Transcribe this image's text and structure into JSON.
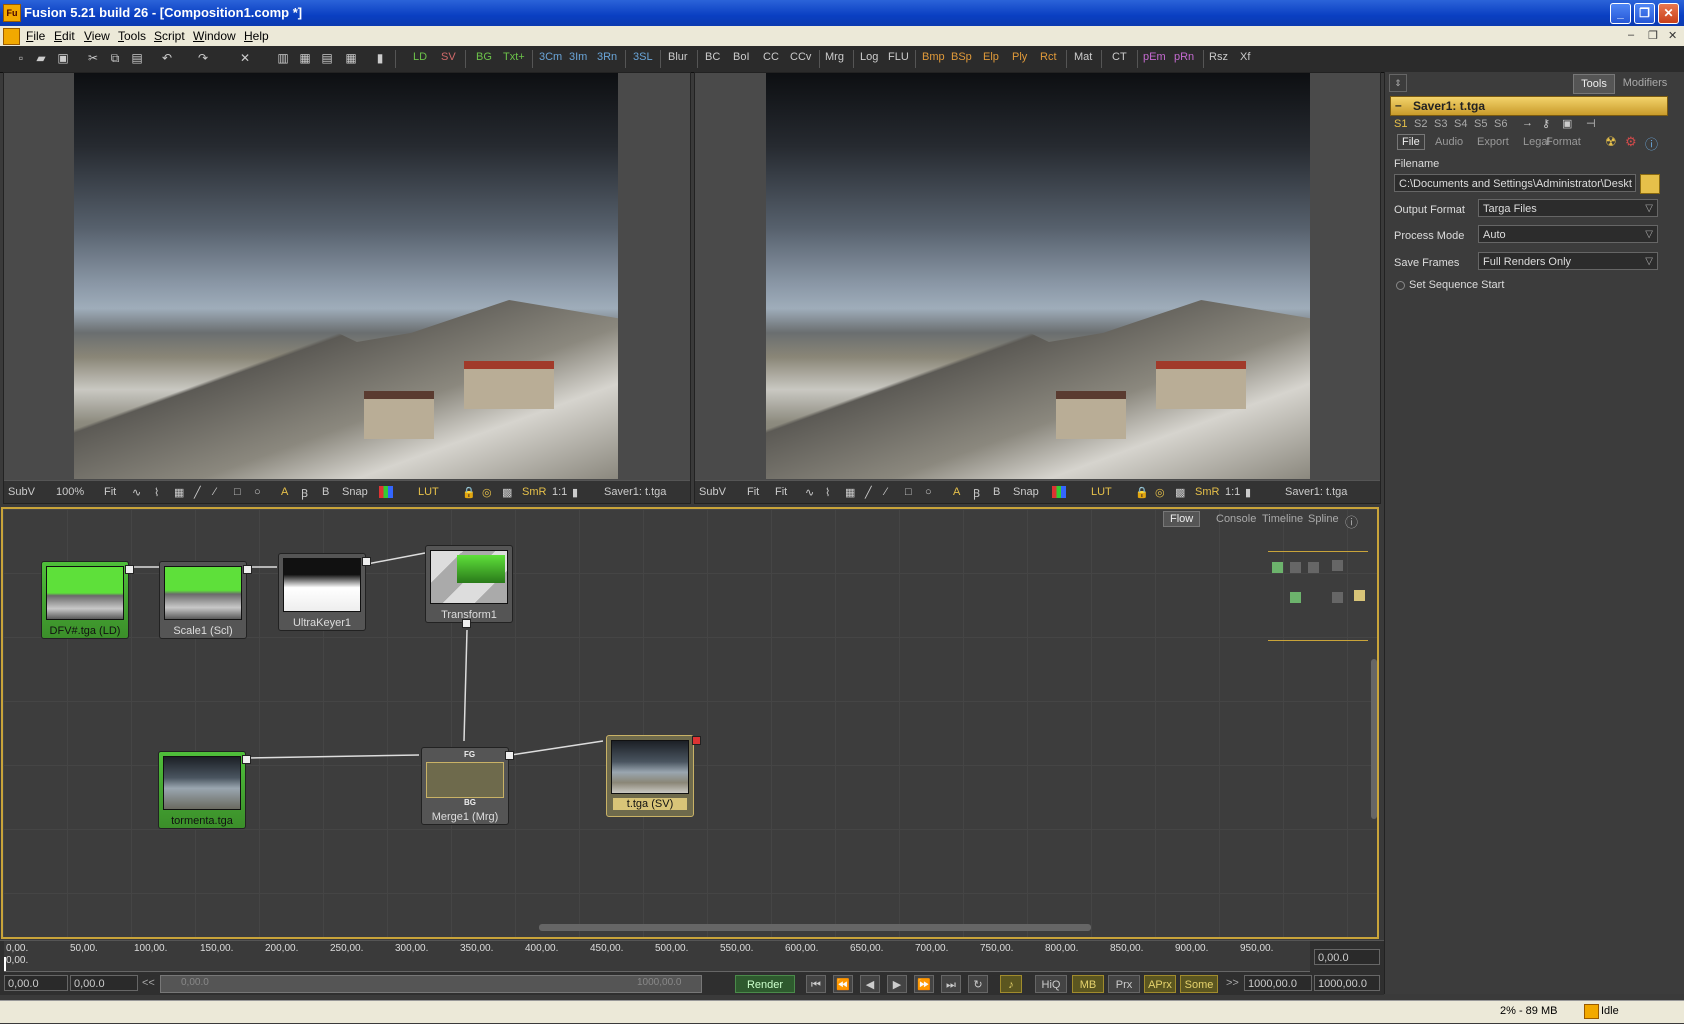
{
  "window": {
    "title": "Fusion 5.21 build 26 - [Composition1.comp *]",
    "app_icon": "Fu"
  },
  "menu": [
    "File",
    "Edit",
    "View",
    "Tools",
    "Script",
    "Window",
    "Help"
  ],
  "toolbar": {
    "groups": [
      [
        "LD",
        "SV"
      ],
      [
        "BG",
        "Txt+"
      ],
      [
        "3Cm",
        "3Im",
        "3Rn"
      ],
      [
        "3SL"
      ],
      [
        "Blur"
      ],
      [
        "BC",
        "BoI",
        "CC",
        "CCv"
      ],
      [
        "Mrg"
      ],
      [
        "Log",
        "FLU"
      ],
      [
        "Bmp",
        "BSp",
        "Elp",
        "Ply",
        "Rct"
      ],
      [
        "Mat"
      ],
      [
        "CT"
      ],
      [
        "pEm",
        "pRn"
      ],
      [
        "Rsz",
        "Xf"
      ]
    ]
  },
  "viewers": [
    {
      "subv": "SubV",
      "zoom": "100%",
      "fit": "Fit",
      "snap": "Snap",
      "lut": "LUT",
      "smr": "SmR",
      "onetoone": "1:1",
      "view_name": "Saver1: t.tga"
    },
    {
      "subv": "SubV",
      "zoom": "Fit",
      "fit": "Fit",
      "snap": "Snap",
      "lut": "LUT",
      "smr": "SmR",
      "onetoone": "1:1",
      "view_name": "Saver1: t.tga"
    }
  ],
  "panel": {
    "tabs": [
      "Tools",
      "Modifiers"
    ],
    "tool_name": "Saver1: t.tga",
    "slots": [
      "S1",
      "S2",
      "S3",
      "S4",
      "S5",
      "S6"
    ],
    "sub_tabs": [
      "File",
      "Audio",
      "Export",
      "Legal",
      "Format"
    ],
    "filename_label": "Filename",
    "filename_value": "C:\\Documents and Settings\\Administrator\\Deskt",
    "output_format_label": "Output Format",
    "output_format_value": "Targa Files",
    "process_mode_label": "Process Mode",
    "process_mode_value": "Auto",
    "save_frames_label": "Save Frames",
    "save_frames_value": "Full Renders Only",
    "set_sequence_start": "Set Sequence Start"
  },
  "flow": {
    "tabs": [
      "Flow",
      "Console",
      "Timeline",
      "Spline"
    ],
    "nodes": [
      "DFV#.tga (LD)",
      "Scale1 (Scl)",
      "UltraKeyer1",
      "Transform1",
      "tormenta.tga",
      "Merge1 (Mrg)",
      "t.tga (SV)"
    ],
    "merge_fg": "FG",
    "merge_bg": "BG"
  },
  "timeline": {
    "ticks": [
      "0,00.",
      "50,00.",
      "100,00.",
      "150,00.",
      "200,00.",
      "250,00.",
      "300,00.",
      "350,00.",
      "400,00.",
      "450,00.",
      "500,00.",
      "550,00.",
      "600,00.",
      "650,00.",
      "700,00.",
      "750,00.",
      "800,00.",
      "850,00.",
      "900,00.",
      "950,00."
    ],
    "current_time": "0,00.",
    "right_field": "0,00.0",
    "global_start": "0,00.0",
    "render_start": "0,00.0",
    "range_start_label": "0,00.0",
    "range_end_label": "1000,00.0",
    "rewind_label": "<<",
    "forward_label": ">>",
    "render_label": "Render",
    "toggles": [
      "HiQ",
      "MB",
      "Prx",
      "APrx",
      "Some"
    ],
    "render_end": "1000,00.0",
    "global_end": "1000,00.0"
  },
  "status": {
    "memory": "2% - 89 MB",
    "state": "Idle"
  },
  "colors": {
    "accent": "#c9a43a",
    "node_green": "#4fbf3a",
    "title_blue": "#0a3fc2"
  }
}
